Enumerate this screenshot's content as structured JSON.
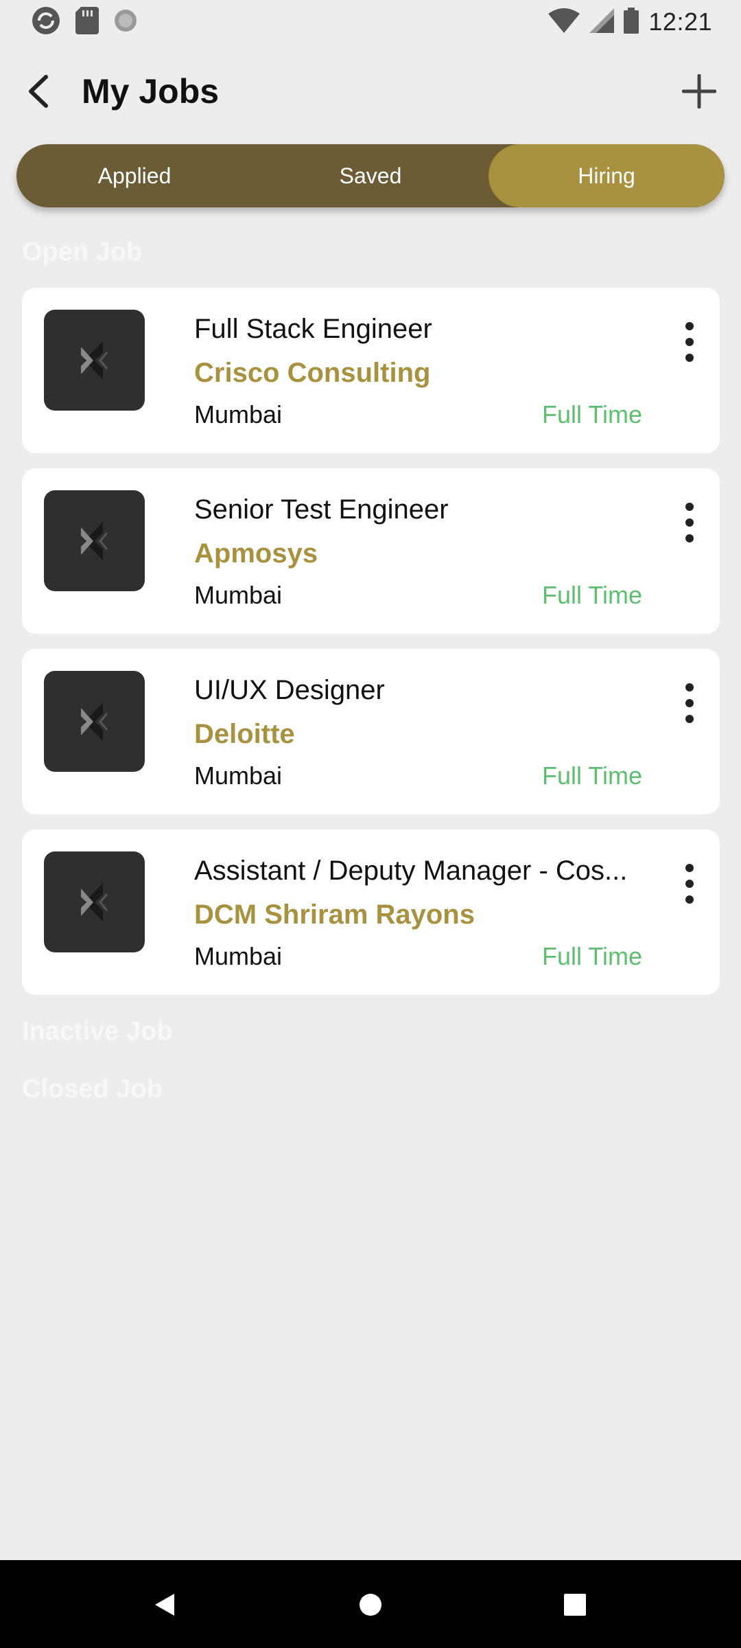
{
  "status_bar": {
    "time": "12:21",
    "icons_left": [
      "sync-app-icon",
      "sd-card-icon",
      "loading-circle-icon"
    ],
    "icons_right": [
      "wifi-icon",
      "cell-signal-icon",
      "battery-icon"
    ]
  },
  "app_bar": {
    "title": "My Jobs",
    "back_icon": "back-arrow-icon",
    "add_icon": "plus-icon"
  },
  "tabs": [
    {
      "label": "Applied",
      "active": false
    },
    {
      "label": "Saved",
      "active": false
    },
    {
      "label": "Hiring",
      "active": true
    }
  ],
  "sections": {
    "open": "Open Job",
    "inactive": "Inactive Job",
    "closed": "Closed Job"
  },
  "jobs": [
    {
      "title": "Full Stack Engineer",
      "company": "Crisco Consulting",
      "location": "Mumbai",
      "type": "Full Time"
    },
    {
      "title": "Senior Test Engineer",
      "company": "Apmosys",
      "location": "Mumbai",
      "type": "Full Time"
    },
    {
      "title": "UI/UX Designer",
      "company": "Deloitte",
      "location": "Mumbai",
      "type": "Full Time"
    },
    {
      "title": "Assistant / Deputy Manager - Cos...",
      "company": "DCM Shriram Rayons",
      "location": "Mumbai",
      "type": "Full Time"
    }
  ],
  "colors": {
    "accent": "#a8913f",
    "tab_bg": "#6b5c35",
    "job_type": "#5cbf6f",
    "background": "#ededed"
  }
}
